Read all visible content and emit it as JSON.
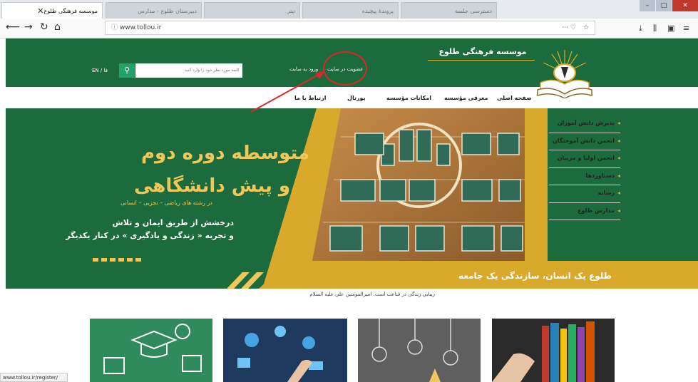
{
  "browser": {
    "active_tab_title": "موسسه فرهنگی طلوع",
    "inactive_tabs": [
      "دبیرستان طلوع - مدارس",
      "تیتر",
      "پروندهٔ پیچیده",
      "دسترسی جلسه"
    ],
    "url": "www.tollou.ir",
    "status_url": "www.tollou.ir/register/"
  },
  "header": {
    "site_name": "موسسه فرهنگی طلوع",
    "register_link": "عضویت در سایت",
    "login_link": "ورود به سایت",
    "search_placeholder": "کلمه مورد نظر خود را وارد کنید",
    "lang": "EN / فا"
  },
  "menu": [
    "صفحه اصلی",
    "معرفی مؤسسه",
    "امکانات مؤسسه",
    "پورتال",
    "ارتباط با ما"
  ],
  "side_menu": [
    "پذیرش دانش آموزان",
    "انجمن دانش آموختگان",
    "انجمن اولیا و مربیان",
    "دستاوردها",
    "رسانه",
    "مدارس طلوع"
  ],
  "banner": {
    "headline_1": "متوسطه دوره دوم",
    "headline_2": "و پیش دانشگاهی",
    "fields": "در رشته های ریاضی – تجربی – انسانی",
    "tagline_1": "درخشش از طریق ایمان و تلاش",
    "tagline_2": "و تجربه « زندگی و یادگیری » در کنار یکدیگر",
    "slogan": "طلوع یک انسان، سازندگی یک جامعه"
  },
  "caption": "زیبایی زندگی در قناعت است. امیرالمومنین علی علیه السلام",
  "colors": {
    "brand_green": "#1b6b3c",
    "accent_gold": "#d9a92b",
    "highlight_red": "#e0262b"
  }
}
